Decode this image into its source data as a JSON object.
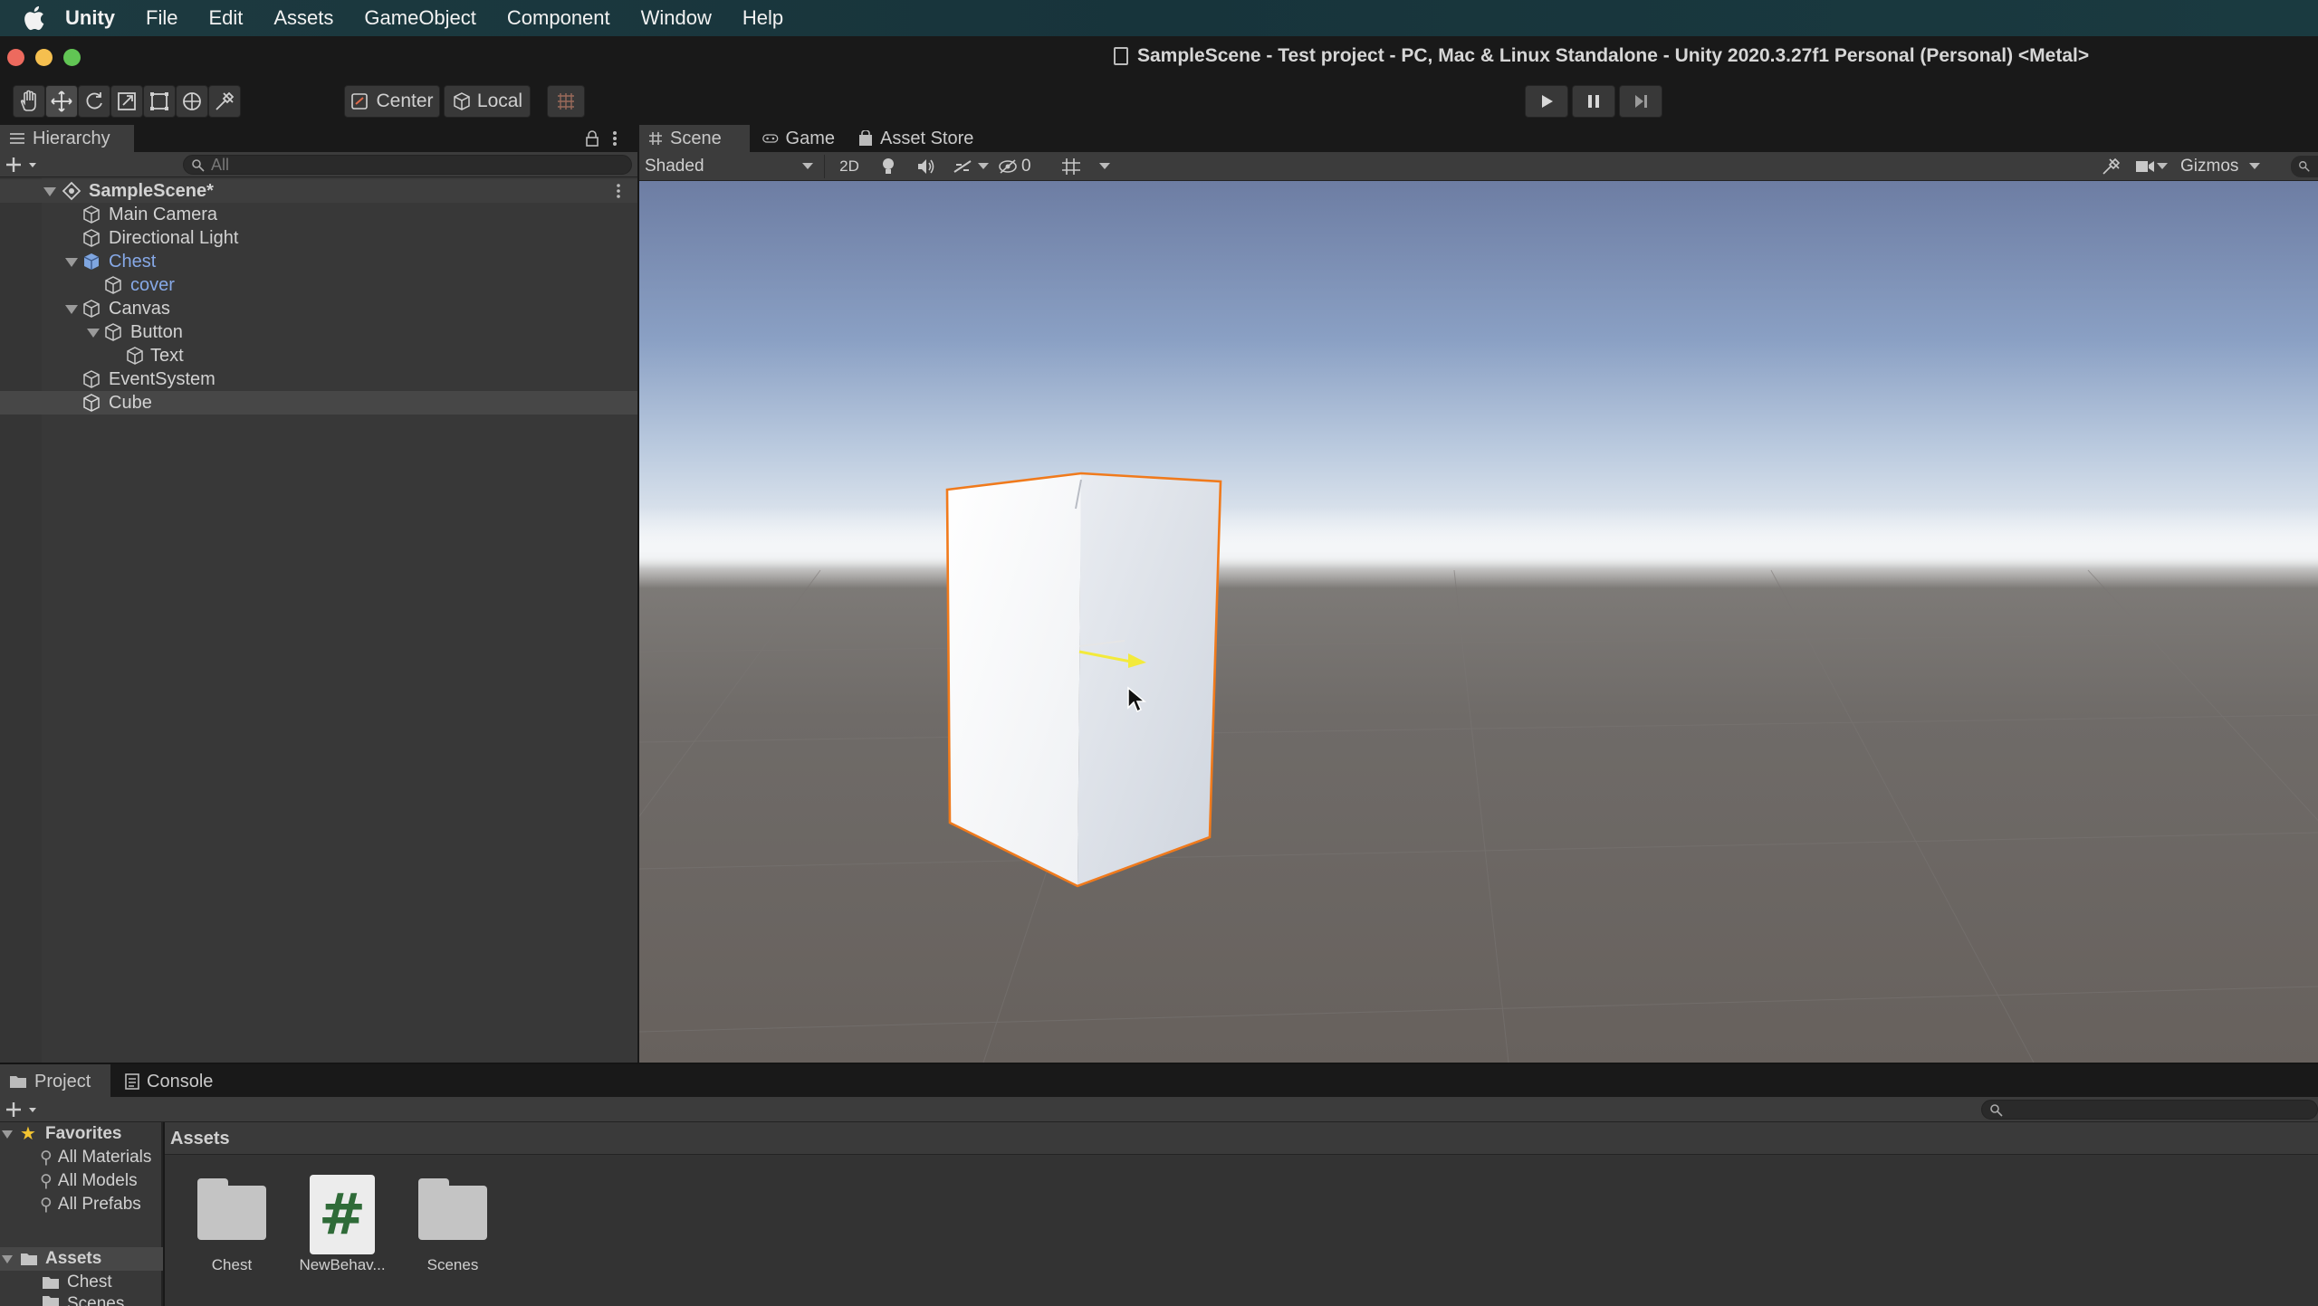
{
  "menubar": {
    "items": [
      "Unity",
      "File",
      "Edit",
      "Assets",
      "GameObject",
      "Component",
      "Window",
      "Help"
    ]
  },
  "window": {
    "title": "SampleScene - Test project - PC, Mac & Linux Standalone - Unity 2020.3.27f1 Personal (Personal) <Metal>"
  },
  "toolbar": {
    "pivot_label": "Center",
    "space_label": "Local"
  },
  "hierarchy": {
    "tab_label": "Hierarchy",
    "search_placeholder": "All",
    "scene_name": "SampleScene*",
    "items": [
      {
        "label": "Main Camera"
      },
      {
        "label": "Directional Light"
      },
      {
        "label": "Chest"
      },
      {
        "label": "cover"
      },
      {
        "label": "Canvas"
      },
      {
        "label": "Button"
      },
      {
        "label": "Text"
      },
      {
        "label": "EventSystem"
      },
      {
        "label": "Cube"
      }
    ]
  },
  "scene_view": {
    "tabs": [
      "Scene",
      "Game",
      "Asset Store"
    ],
    "shading_mode": "Shaded",
    "mode_2d_label": "2D",
    "hidden_count": "0",
    "gizmos_label": "Gizmos"
  },
  "project": {
    "tabs": [
      "Project",
      "Console"
    ],
    "favorites_label": "Favorites",
    "favorites": [
      "All Materials",
      "All Models",
      "All Prefabs"
    ],
    "assets_label": "Assets",
    "asset_folders": [
      "Chest",
      "Scenes"
    ],
    "breadcrumb": "Assets",
    "assets": [
      {
        "name": "Chest",
        "kind": "folder"
      },
      {
        "name": "NewBehav...",
        "kind": "script"
      },
      {
        "name": "Scenes",
        "kind": "folder"
      }
    ]
  },
  "colors": {
    "selection_outline": "#f07a1c",
    "prefab_blue": "#86a8e6",
    "menubar_bg": "#17343b"
  }
}
